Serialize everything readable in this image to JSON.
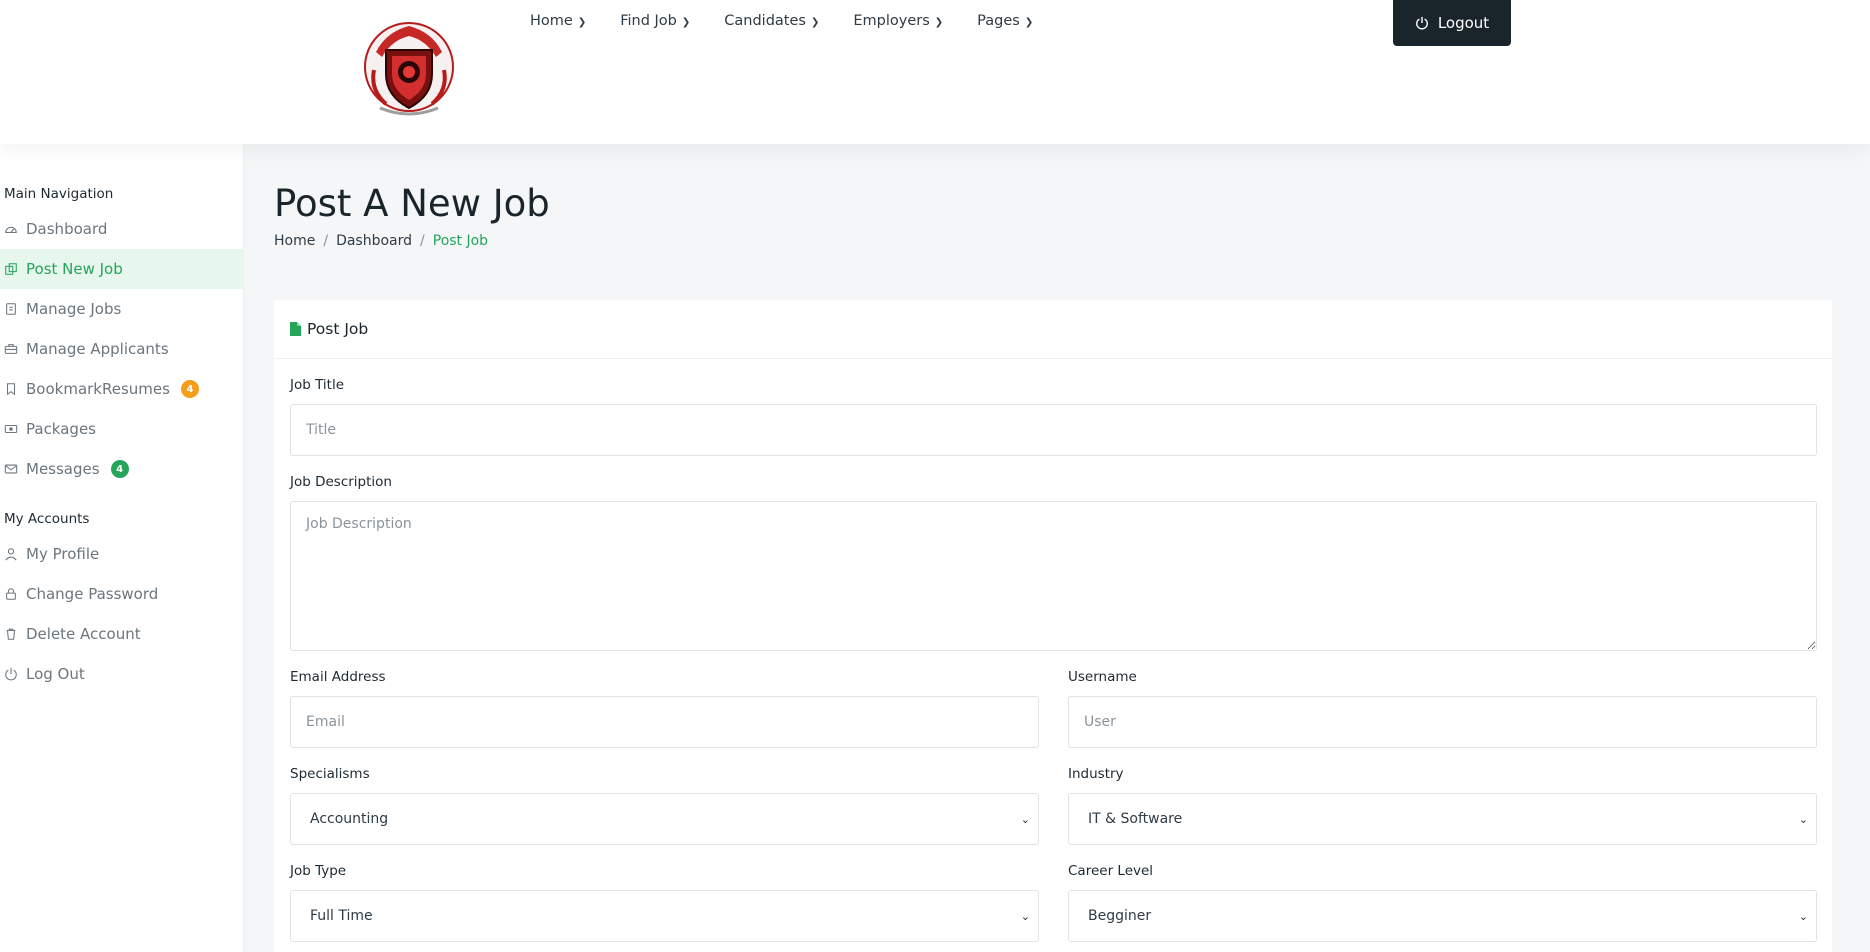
{
  "header": {
    "logo_icon": "guild-crest-logo",
    "nav": [
      {
        "label": "Home"
      },
      {
        "label": "Find Job"
      },
      {
        "label": "Candidates"
      },
      {
        "label": "Employers"
      },
      {
        "label": "Pages"
      }
    ],
    "logout_label": "Logout"
  },
  "sidebar": {
    "group1_title": "Main Navigation",
    "group1_items": [
      {
        "label": "Dashboard",
        "icon": "dashboard-gauge-icon"
      },
      {
        "label": "Post New Job",
        "icon": "post-job-icon",
        "active": true
      },
      {
        "label": "Manage Jobs",
        "icon": "manage-jobs-icon"
      },
      {
        "label": "Manage Applicants",
        "icon": "briefcase-icon"
      },
      {
        "label": "BookmarkResumes",
        "icon": "bookmark-icon",
        "badge": "4",
        "badge_color": "#f59e1a"
      },
      {
        "label": "Packages",
        "icon": "money-icon"
      },
      {
        "label": "Messages",
        "icon": "envelope-icon",
        "badge": "4",
        "badge_color": "#25a55a"
      }
    ],
    "group2_title": "My Accounts",
    "group2_items": [
      {
        "label": "My Profile",
        "icon": "user-icon"
      },
      {
        "label": "Change Password",
        "icon": "lock-icon"
      },
      {
        "label": "Delete Account",
        "icon": "trash-icon"
      },
      {
        "label": "Log Out",
        "icon": "power-icon"
      }
    ]
  },
  "page": {
    "title": "Post A New Job",
    "breadcrumb": [
      "Home",
      "Dashboard",
      "Post Job"
    ]
  },
  "form": {
    "card_title": "Post Job",
    "job_title_label": "Job Title",
    "job_title_placeholder": "Title",
    "job_description_label": "Job Description",
    "job_description_placeholder": "Job Description",
    "email_label": "Email Address",
    "email_placeholder": "Email",
    "username_label": "Username",
    "username_placeholder": "User",
    "specialisms_label": "Specialisms",
    "specialisms_value": "Accounting",
    "industry_label": "Industry",
    "industry_value": "IT & Software",
    "job_type_label": "Job Type",
    "job_type_value": "Full Time",
    "career_level_label": "Career Level",
    "career_level_value": "Begginer"
  },
  "colors": {
    "accent": "#25a55a",
    "dark": "#1a252b",
    "badge_orange": "#f59e1a"
  }
}
